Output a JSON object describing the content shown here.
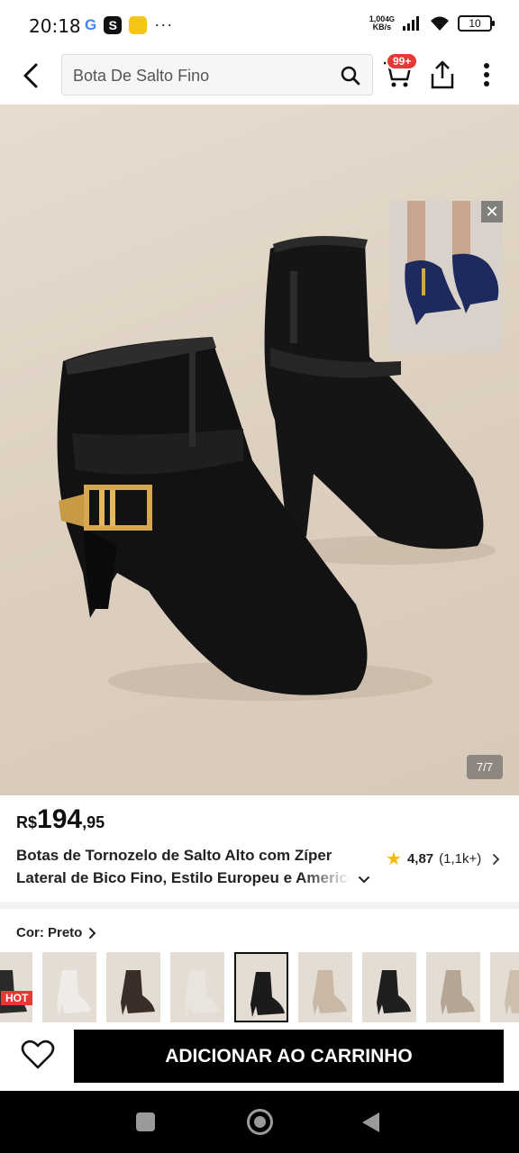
{
  "status_bar": {
    "time": "20:18",
    "net_speed_value": "1,00",
    "net_speed_unit": "KB/s",
    "network_type": "4G",
    "battery": "10"
  },
  "search": {
    "query": "Bota De Salto Fino"
  },
  "cart": {
    "badge": "99+"
  },
  "gallery": {
    "counter": "7/7",
    "video_close": "✕"
  },
  "product": {
    "price_currency": "R$",
    "price_integer": "194",
    "price_decimal": ",95",
    "title_line1": "Botas de Tornozelo de Salto Alto com Zíper",
    "title_line2": "Lateral de Bico Fino, Estilo Europeu e Americano",
    "rating": "4,87",
    "reviews": "(1,1k+)"
  },
  "color_selector": {
    "label": "Cor: Preto",
    "hot_badge": "HOT",
    "swatches": [
      {
        "name": "black-zip",
        "color": "#2a2a2a"
      },
      {
        "name": "white",
        "color": "#efece7"
      },
      {
        "name": "dark-brown",
        "color": "#3b2e28"
      },
      {
        "name": "white-buckle",
        "color": "#e9e5de"
      },
      {
        "name": "black-selected",
        "color": "#1b1b1b"
      },
      {
        "name": "beige",
        "color": "#c9b8a6"
      },
      {
        "name": "black-2",
        "color": "#1f1f1f"
      },
      {
        "name": "taupe",
        "color": "#b5a595"
      },
      {
        "name": "partial",
        "color": "#cdbfae"
      }
    ]
  },
  "bottom_bar": {
    "add_to_cart_label": "ADICIONAR AO CARRINHO"
  },
  "colors": {
    "accent_red": "#e63935",
    "star": "#f5b900",
    "button_bg": "#000000"
  }
}
